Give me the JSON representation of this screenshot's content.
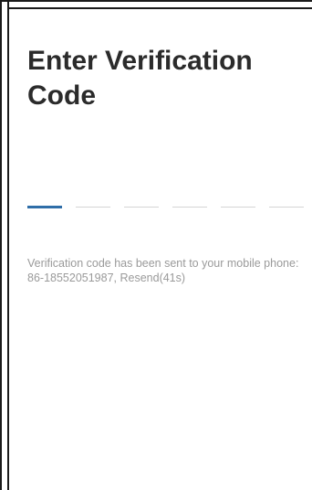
{
  "header": {
    "title_line1": "Enter Verification",
    "title_line2": "Code"
  },
  "code_input": {
    "length": 6,
    "active_index": 0,
    "colors": {
      "active": "#2f6ea8",
      "inactive": "#d5d5d5"
    }
  },
  "message": {
    "line1": "Verification code has been sent to your mobile phone:",
    "line2": "86-18552051987, Resend(41s)"
  },
  "colors": {
    "title": "#2b2b2b",
    "hint": "#9a9a9a",
    "background": "#ffffff"
  }
}
